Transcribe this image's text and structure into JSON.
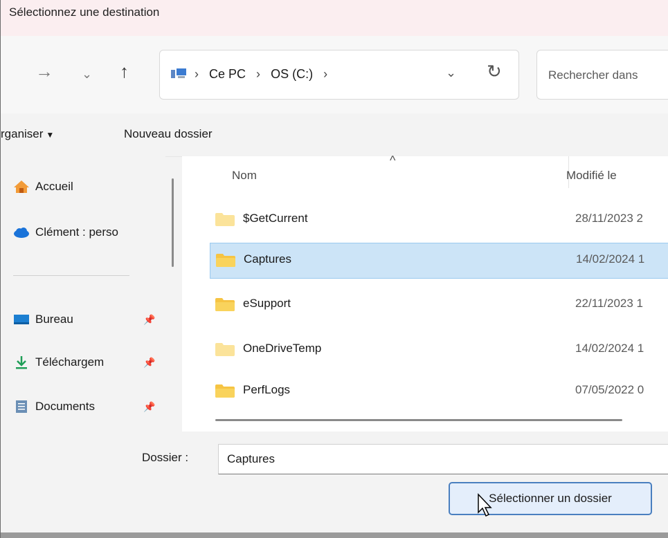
{
  "window": {
    "title": "Sélectionnez une destination"
  },
  "nav": {
    "forward_icon": "arrow-right",
    "history_icon": "chevron-down",
    "up_icon": "arrow-up"
  },
  "address": {
    "crumbs": [
      "Ce PC",
      "OS (C:)"
    ],
    "separator": "›"
  },
  "search": {
    "placeholder": "Rechercher dans"
  },
  "toolbar": {
    "organize": "rganiser",
    "new_folder": "Nouveau dossier"
  },
  "sidebar": {
    "items": [
      {
        "label": "Accueil",
        "icon": "home-icon"
      },
      {
        "label": "Clément : perso",
        "icon": "cloud-icon"
      },
      {
        "label": "Bureau",
        "icon": "desktop-icon",
        "pinned": true
      },
      {
        "label": "Téléchargem",
        "icon": "download-icon",
        "pinned": true
      },
      {
        "label": "Documents",
        "icon": "document-icon",
        "pinned": true
      }
    ]
  },
  "files": {
    "headers": {
      "name": "Nom",
      "modified": "Modifié le"
    },
    "rows": [
      {
        "name": "$GetCurrent",
        "date": "28/11/2023 2",
        "selected": false,
        "light": true
      },
      {
        "name": "Captures",
        "date": "14/02/2024 1",
        "selected": true,
        "light": false
      },
      {
        "name": "eSupport",
        "date": "22/11/2023 1",
        "selected": false,
        "light": false
      },
      {
        "name": "OneDriveTemp",
        "date": "14/02/2024 1",
        "selected": false,
        "light": true
      },
      {
        "name": "PerfLogs",
        "date": "07/05/2022 0",
        "selected": false,
        "light": false
      }
    ]
  },
  "footer": {
    "folder_label": "Dossier :",
    "folder_value": "Captures",
    "select_button": "Sélectionner un dossier"
  },
  "colors": {
    "selection": "#cce4f7",
    "folder": "#f6c443",
    "accent": "#4a7fbf"
  }
}
